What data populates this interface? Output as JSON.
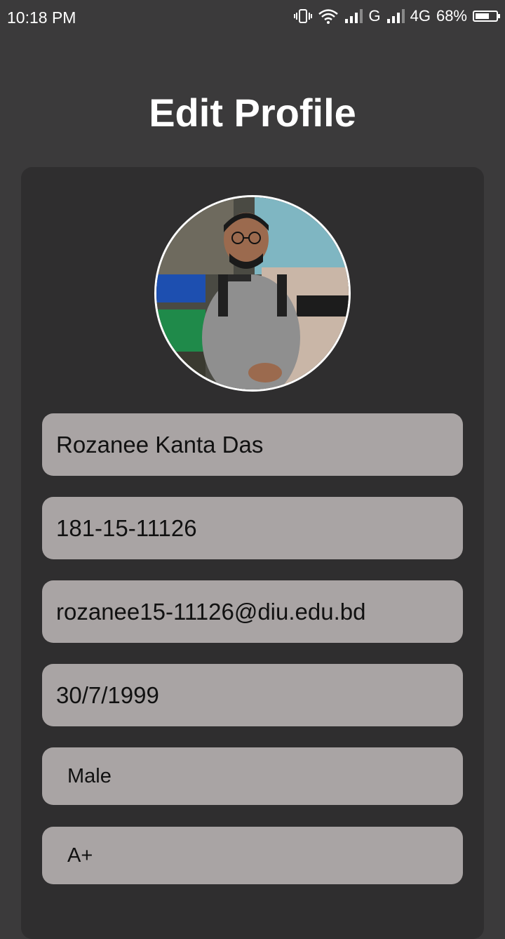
{
  "status_bar": {
    "time": "10:18 PM",
    "network_g": "G",
    "network_4g": "4G",
    "battery_percent_text": "68%",
    "battery_level": 0.68,
    "icons": [
      "vibrate-icon",
      "wifi-icon",
      "signal-icon",
      "signal-icon",
      "battery-icon"
    ]
  },
  "header": {
    "title": "Edit Profile"
  },
  "profile": {
    "name": "Rozanee Kanta Das",
    "student_id": "181-15-11126",
    "email": "rozanee15-11126@diu.edu.bd",
    "date_of_birth": "30/7/1999",
    "gender": "Male",
    "blood_group": "A+"
  },
  "colors": {
    "background": "#3b3a3b",
    "card": "#2f2e2f",
    "field": "#a9a4a4",
    "text_light": "#ffffff",
    "text_dark": "#111111"
  }
}
